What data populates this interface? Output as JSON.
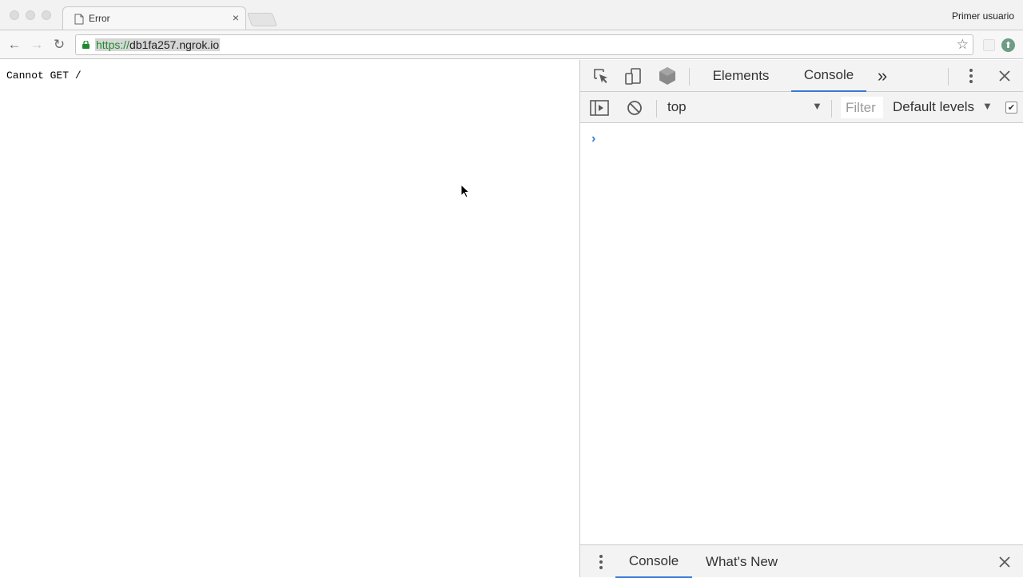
{
  "browser": {
    "tab_title": "Error",
    "tab_close": "×",
    "profile_name": "Primer usuario",
    "url_scheme": "https://",
    "url_host": "db1fa257.ngrok.io"
  },
  "page": {
    "text": "Cannot GET /"
  },
  "devtools": {
    "tabs": [
      "Elements",
      "Console"
    ],
    "active_tab": "Console",
    "more_tabs": "»",
    "context": "top",
    "filter_placeholder": "Filter",
    "levels": "Default levels",
    "prompt": "›",
    "drawer_tabs": [
      "Console",
      "What's New"
    ],
    "drawer_active": "Console",
    "accent_color": "#3879d9"
  }
}
